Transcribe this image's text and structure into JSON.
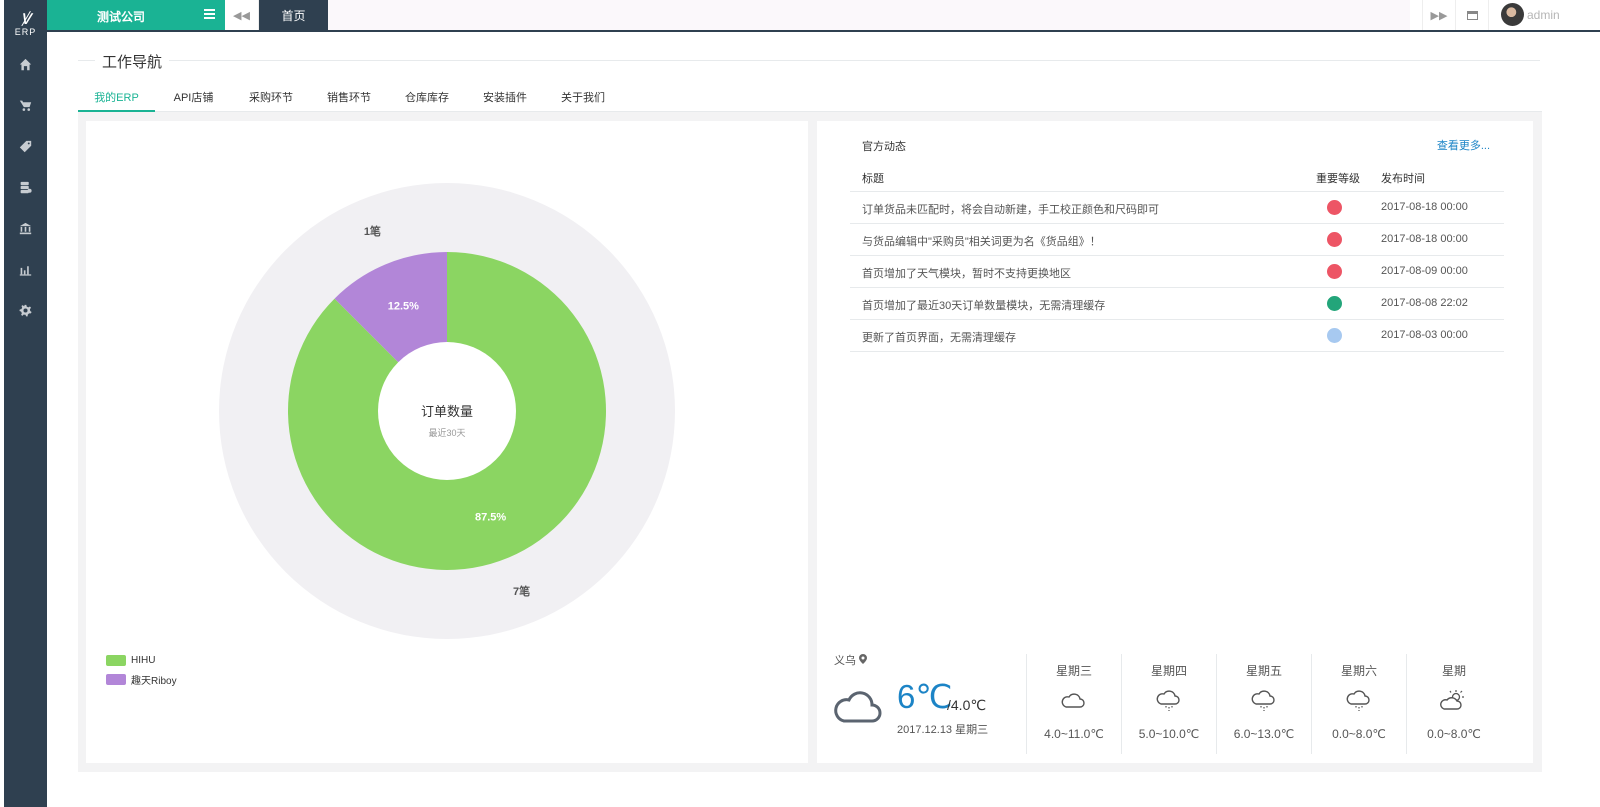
{
  "logo": {
    "mark": "ꝟ",
    "text": "ERP"
  },
  "sidebar": {
    "icons": [
      "home-icon",
      "cart-icon",
      "tag-icon",
      "database-icon",
      "bank-icon",
      "bar-chart-icon",
      "gear-icon"
    ]
  },
  "topbar": {
    "company": "测试公司",
    "home_tab": "首页",
    "username": "admin"
  },
  "nav": {
    "title": "工作导航",
    "tabs": [
      {
        "label": "我的ERP",
        "active": true
      },
      {
        "label": "API店铺"
      },
      {
        "label": "采购环节"
      },
      {
        "label": "销售环节"
      },
      {
        "label": "仓库库存"
      },
      {
        "label": "安装插件"
      },
      {
        "label": "关于我们"
      }
    ]
  },
  "chart_data": {
    "type": "pie",
    "title": "订单数量",
    "subtitle": "最近30天",
    "slices": [
      {
        "name": "HIHU",
        "value": 7,
        "percent": "87.5%",
        "count_label": "7笔",
        "color": "#8bd562"
      },
      {
        "name": "趣天Riboy",
        "value": 1,
        "percent": "12.5%",
        "count_label": "1笔",
        "color": "#b286d8"
      }
    ],
    "legend_position": "bottom-left"
  },
  "news": {
    "title": "官方动态",
    "more": "查看更多...",
    "columns": [
      "标题",
      "重要等级",
      "发布时间"
    ],
    "rows": [
      {
        "title": "订单货品未匹配时，将会自动新建，手工校正颜色和尺码即可",
        "level_color": "#ed5565",
        "time": "2017-08-18 00:00"
      },
      {
        "title": "与货品编辑中\"采购员\"相关词更为名《货品组》！",
        "level_color": "#ed5565",
        "time": "2017-08-18 00:00"
      },
      {
        "title": "首页增加了天气模块，暂时不支持更换地区",
        "level_color": "#ed5565",
        "time": "2017-08-09 00:00"
      },
      {
        "title": "首页增加了最近30天订单数量模块，无需清理缓存",
        "level_color": "#23a57a",
        "time": "2017-08-08 22:02"
      },
      {
        "title": "更新了首页界面，无需清理缓存",
        "level_color": "#a7c9f0",
        "time": "2017-08-03 00:00"
      }
    ]
  },
  "weather": {
    "city": "义乌",
    "temp": "6℃",
    "low": "/4.0℃",
    "date": "2017.12.13 星期三",
    "icon": "cloud-icon",
    "days": [
      {
        "name": "星期三",
        "range": "4.0~11.0℃",
        "icon": "cloud-icon"
      },
      {
        "name": "星期四",
        "range": "5.0~10.0℃",
        "icon": "rain-cloud-icon"
      },
      {
        "name": "星期五",
        "range": "6.0~13.0℃",
        "icon": "rain-cloud-icon"
      },
      {
        "name": "星期六",
        "range": "0.0~8.0℃",
        "icon": "rain-cloud-icon"
      },
      {
        "name": "星期",
        "range": "0.0~8.0℃",
        "icon": "partly-sunny-icon"
      }
    ]
  }
}
